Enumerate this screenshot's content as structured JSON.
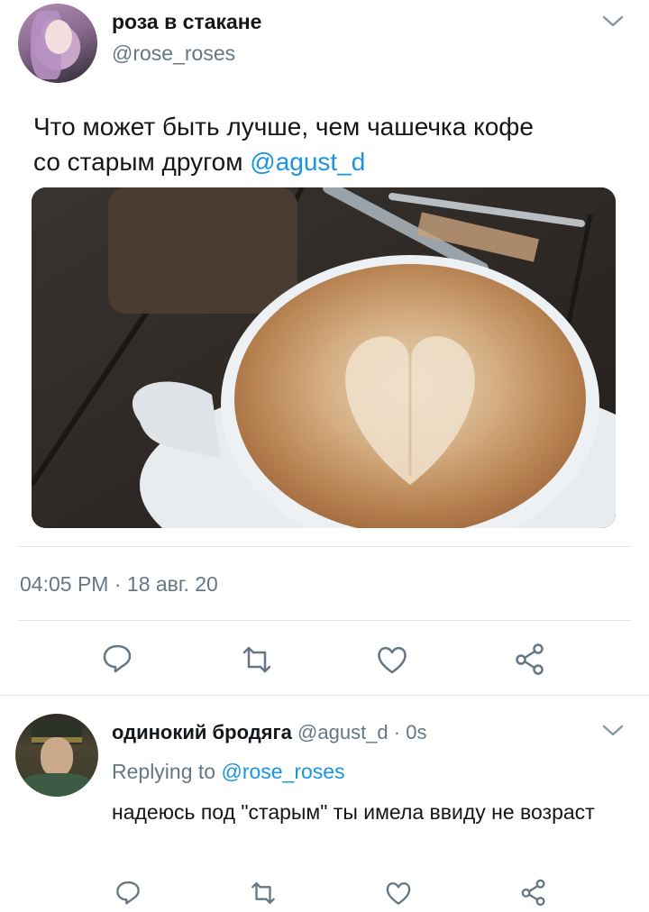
{
  "tweet": {
    "display_name": "роза в стакане",
    "handle": "@rose_roses",
    "text_part1": "Что может быть лучше, чем чашечка  кофе",
    "text_part2": "со старым другом ",
    "text_mention": "@agust_d",
    "image_alt": "latte art coffee cup with cutlery",
    "time": "04:05 PM",
    "date_separator": " · ",
    "date": "18 авг. 20"
  },
  "actions": {
    "reply_icon": "speech-bubble",
    "retweet_icon": "retweet-arrows",
    "like_icon": "heart",
    "share_icon": "share-nodes"
  },
  "reply": {
    "display_name": "одинокий бродяга",
    "handle": "@agust_d",
    "time_sep": " · ",
    "time": "0s",
    "replying_to_label": "Replying to ",
    "replying_to_handle": "@rose_roses",
    "text": "надеюсь под \"старым\" ты имела ввиду не возраст"
  },
  "colors": {
    "link": "#1b95e0",
    "secondary_text": "#657786",
    "primary_text": "#14171a",
    "divider": "#e1e8ed"
  }
}
